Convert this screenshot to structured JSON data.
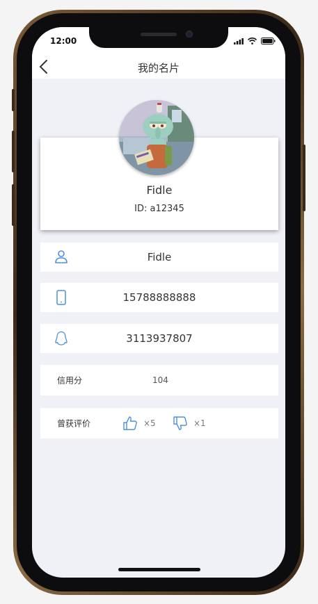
{
  "status_bar": {
    "time": "12:00"
  },
  "nav": {
    "title": "我的名片"
  },
  "profile": {
    "name": "Fidle",
    "id": "ID: a12345"
  },
  "info_rows": [
    {
      "icon": "user-icon",
      "value": "Fidle"
    },
    {
      "icon": "phone-icon",
      "value": "15788888888"
    },
    {
      "icon": "qq-icon",
      "value": "3113937807"
    }
  ],
  "credit": {
    "label": "信用分",
    "value": "104"
  },
  "ratings": {
    "label": "曾获评价",
    "likes": {
      "icon": "thumbs-up-icon",
      "count": "×5"
    },
    "dislikes": {
      "icon": "thumbs-down-icon",
      "count": "×1"
    }
  },
  "colors": {
    "accent": "#4a90e2",
    "background": "#f0f1f6"
  }
}
